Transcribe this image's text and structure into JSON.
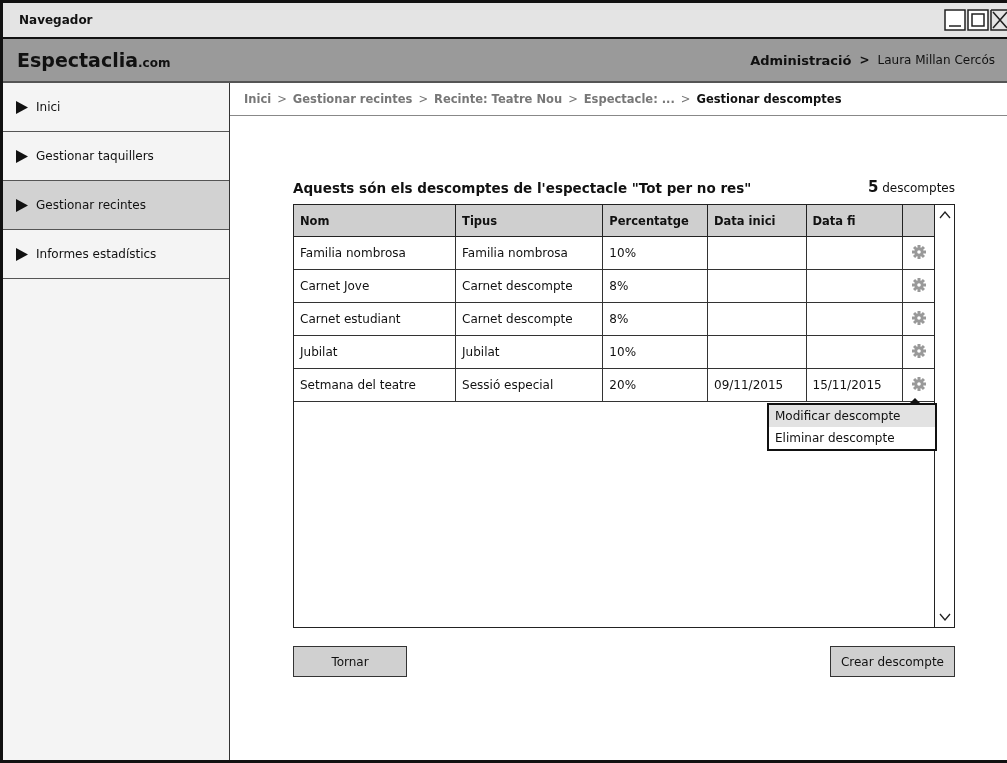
{
  "window": {
    "title": "Navegador"
  },
  "header": {
    "logo": "Espectaclia",
    "logo_suffix": ".com",
    "section": "Administració",
    "separator": ">",
    "user": "Laura Millan Cercós"
  },
  "sidebar": {
    "items": [
      {
        "label": "Inici",
        "selected": false
      },
      {
        "label": "Gestionar taquillers",
        "selected": false
      },
      {
        "label": "Gestionar recintes",
        "selected": true
      },
      {
        "label": "Informes estadístics",
        "selected": false
      }
    ]
  },
  "breadcrumb": [
    {
      "label": "Inici",
      "current": false
    },
    {
      "label": "Gestionar recintes",
      "current": false
    },
    {
      "label": "Recinte: Teatre Nou",
      "current": false
    },
    {
      "label": "Espectacle: ...",
      "current": false
    },
    {
      "label": "Gestionar descomptes",
      "current": true
    }
  ],
  "breadcrumb_separator": ">",
  "heading": "Aquests són els descomptes de l'espectacle \"Tot per no res\"",
  "count": {
    "value": "5",
    "label": "descomptes"
  },
  "table": {
    "columns": [
      "Nom",
      "Tipus",
      "Percentatge",
      "Data inici",
      "Data fi"
    ],
    "rows": [
      [
        "Familia nombrosa",
        "Familia nombrosa",
        "10%",
        "",
        ""
      ],
      [
        "Carnet Jove",
        "Carnet descompte",
        "8%",
        "",
        ""
      ],
      [
        "Carnet estudiant",
        "Carnet descompte",
        "8%",
        "",
        ""
      ],
      [
        "Jubilat",
        "Jubilat",
        "10%",
        "",
        ""
      ],
      [
        "Setmana del teatre",
        "Sessió especial",
        "20%",
        "09/11/2015",
        "15/11/2015"
      ]
    ]
  },
  "menu": {
    "items": [
      {
        "label": "Modificar descompte",
        "selected": true
      },
      {
        "label": "Eliminar descompte",
        "selected": false
      }
    ]
  },
  "buttons": {
    "back": "Tornar",
    "create": "Crear descompte"
  }
}
